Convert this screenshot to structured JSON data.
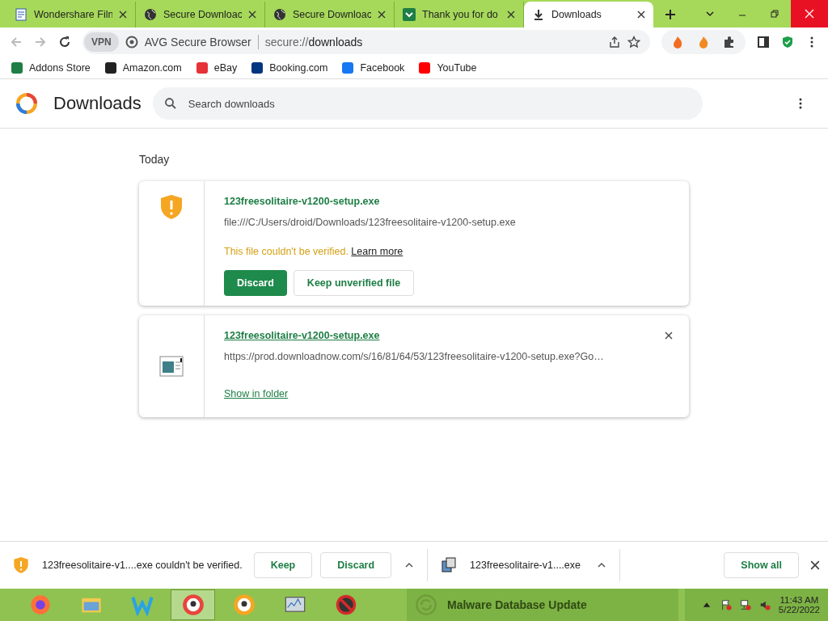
{
  "tabs": [
    {
      "title": "Wondershare Filn",
      "selected": false
    },
    {
      "title": "Secure Downloac",
      "selected": false
    },
    {
      "title": "Secure Downloac",
      "selected": false
    },
    {
      "title": "Thank you for do",
      "selected": false
    },
    {
      "title": "Downloads",
      "selected": true
    }
  ],
  "toolbar": {
    "vpn": "VPN",
    "site_label": "AVG Secure Browser",
    "url_scheme": "secure://",
    "url_path": "downloads"
  },
  "bookmarks": [
    {
      "label": "Addons Store",
      "color": "#1e7e45"
    },
    {
      "label": "Amazon.com",
      "color": "#222222"
    },
    {
      "label": "eBay",
      "color": "#e53238"
    },
    {
      "label": "Booking.com",
      "color": "#003580"
    },
    {
      "label": "Facebook",
      "color": "#1877f2"
    },
    {
      "label": "YouTube",
      "color": "#ff0000"
    }
  ],
  "header": {
    "title": "Downloads",
    "search_placeholder": "Search downloads"
  },
  "section": "Today",
  "downloads": [
    {
      "kind": "dangerous",
      "name": "123freesolitaire-v1200-setup.exe",
      "path": "file:///C:/Users/droid/Downloads/123freesolitaire-v1200-setup.exe",
      "warning": "This file couldn't be verified.",
      "learn_more": "Learn more",
      "buttons": [
        "Discard",
        "Keep unverified file"
      ]
    },
    {
      "kind": "complete",
      "name": "123freesolitaire-v1200-setup.exe",
      "path": "https://prod.downloadnow.com/s/16/81/64/53/123freesolitaire-v1200-setup.exe?Go…",
      "action": "Show in folder"
    }
  ],
  "shelf": {
    "items": [
      {
        "kind": "dangerous",
        "text": "123freesolitaire-v1....exe couldn't be verified.",
        "buttons": [
          "Keep",
          "Discard"
        ]
      },
      {
        "kind": "complete",
        "text": "123freesolitaire-v1....exe"
      }
    ],
    "show_all": "Show all"
  },
  "taskbar": {
    "apps": [
      {
        "selected": false
      },
      {
        "selected": false
      },
      {
        "selected": false
      },
      {
        "selected": true
      },
      {
        "selected": false
      },
      {
        "selected": false
      },
      {
        "selected": false
      }
    ],
    "notification": "Malware Database Update",
    "time": "11:43 AM",
    "date": "5/22/2022"
  }
}
